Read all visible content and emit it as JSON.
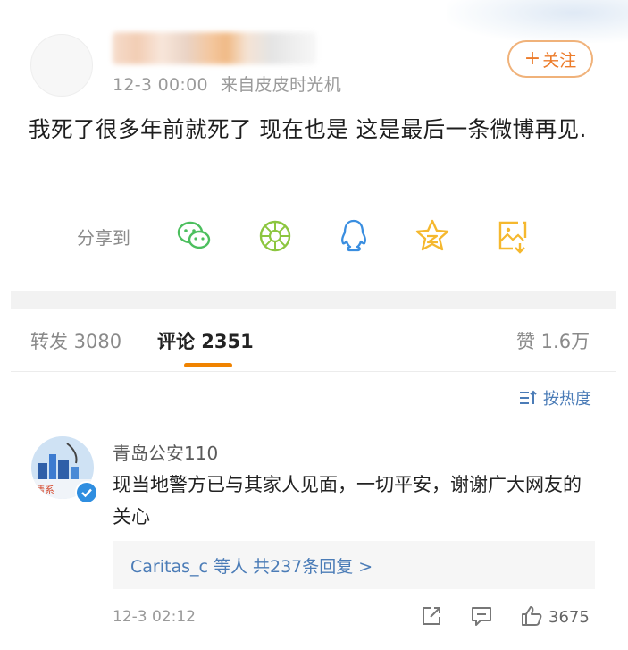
{
  "post": {
    "time": "12-3 00:00",
    "source": "来自皮皮时光机",
    "follow_label": "关注",
    "text": "我死了很多年前就死了 现在也是 这是最后一条微博再见."
  },
  "share": {
    "label": "分享到",
    "icons": [
      "wechat-icon",
      "moments-icon",
      "qq-icon",
      "qzone-icon",
      "save-image-icon"
    ]
  },
  "tabs": {
    "repost": "转发 3080",
    "comments": "评论 2351",
    "likes": "赞 1.6万"
  },
  "sort": {
    "label": "按热度"
  },
  "comment": {
    "author": "青岛公安110",
    "avatar_text": "情系",
    "text": "现当地警方已与其家人见面，一切平安，谢谢广大网友的关心",
    "replies_prefix": "Caritas_c 等人 ",
    "replies_suffix": "共237条回复 >",
    "time": "12-3 02:12",
    "likes": "3675"
  },
  "colors": {
    "accent_orange": "#f08300",
    "link_blue": "#4b7cb7",
    "wechat_green": "#4cbf5e",
    "qq_blue": "#3a8ee0",
    "qzone_yellow": "#f5b82e"
  }
}
